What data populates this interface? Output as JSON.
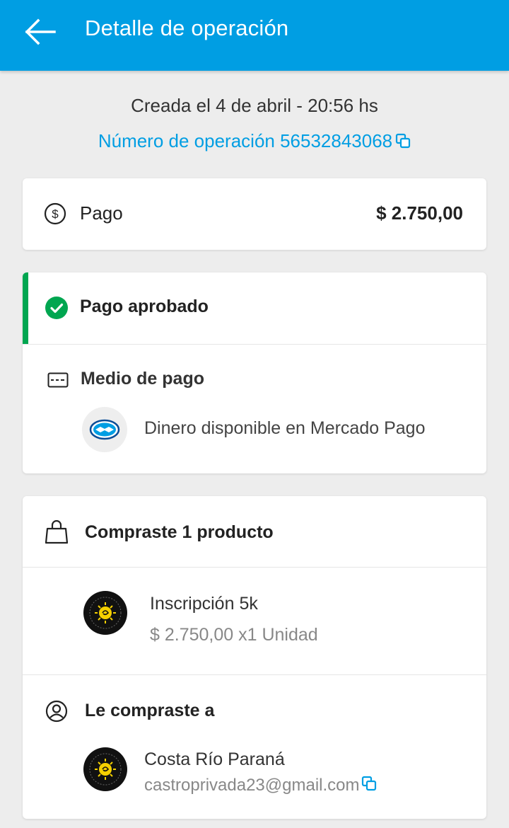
{
  "header": {
    "title": "Detalle de operación",
    "back_icon": "arrow-left-icon",
    "background": "#009ee3"
  },
  "operation": {
    "created": "Creada el 4 de abril - 20:56 hs",
    "number_label": "Número de operación 56532843068",
    "copy_icon": "copy-icon"
  },
  "payment": {
    "icon": "dollar-circle-icon",
    "label": "Pago",
    "amount": "$ 2.750,00"
  },
  "status": {
    "icon": "check-circle-icon",
    "label": "Pago aprobado",
    "color": "#00a650",
    "method_icon": "credit-card-icon",
    "method_label": "Medio de pago",
    "method_logo": "mercado-pago-handshake-logo",
    "method_value": "Dinero disponible en Mercado Pago"
  },
  "purchase": {
    "bag_icon": "shopping-bag-icon",
    "label": "Compraste 1 producto",
    "item": {
      "name": "Inscripción 5k",
      "price": "$ 2.750,00 x1 Unidad"
    },
    "seller_icon": "user-circle-icon",
    "seller_label": "Le compraste a",
    "seller": {
      "name": "Costa Río Paraná",
      "email": "castroprivada23@gmail.com"
    }
  },
  "colors": {
    "accent": "#009ee3",
    "success": "#00a650",
    "background": "#ededed"
  }
}
